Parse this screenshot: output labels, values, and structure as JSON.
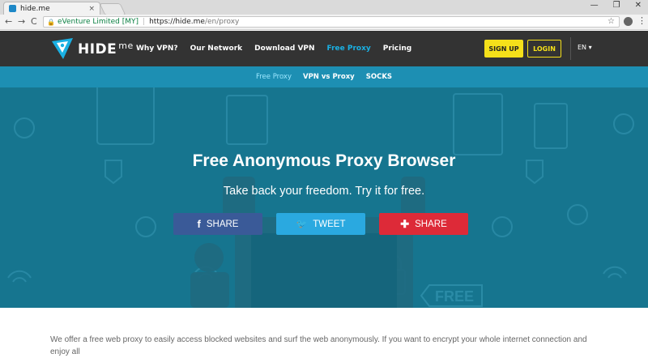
{
  "browser": {
    "tab_title": "hide.me",
    "tab_close": "×",
    "window_controls": [
      "—",
      "❐",
      "✕"
    ],
    "nav": {
      "back": "←",
      "forward": "→",
      "reload": "C"
    },
    "address": {
      "org": "eVenture Limited [MY]",
      "url_host": "https://hide.me",
      "url_path": "/en/proxy"
    }
  },
  "header": {
    "logo_text": "HIDE",
    "logo_suffix": "me",
    "nav_items": [
      {
        "label": "Why VPN?"
      },
      {
        "label": "Our Network"
      },
      {
        "label": "Download VPN"
      },
      {
        "label": "Free Proxy"
      },
      {
        "label": "Pricing"
      }
    ],
    "active_nav": "Free Proxy",
    "signup_label": "SIGN UP",
    "login_label": "LOGIN",
    "language": "EN ▾",
    "accent_color": "#1ab0e3",
    "button_color": "#f5e01a"
  },
  "subnav": {
    "items": [
      {
        "label": "Free Proxy"
      },
      {
        "label": "VPN vs Proxy"
      },
      {
        "label": "SOCKS"
      }
    ]
  },
  "hero": {
    "title": "Free Anonymous Proxy Browser",
    "subtitle": "Take back your freedom. Try it for free.",
    "badge": "FREE",
    "share_buttons": [
      {
        "icon": "f",
        "label": "SHARE",
        "color": "#3a5a98"
      },
      {
        "icon": "🐦",
        "label": "TWEET",
        "color": "#2aa9e0"
      },
      {
        "icon": "✚",
        "label": "SHARE",
        "color": "#dd2a38"
      }
    ]
  },
  "body": {
    "text": "We offer a free web proxy to easily access blocked websites and surf the web anonymously. If you want to encrypt your whole internet connection and enjoy all"
  }
}
